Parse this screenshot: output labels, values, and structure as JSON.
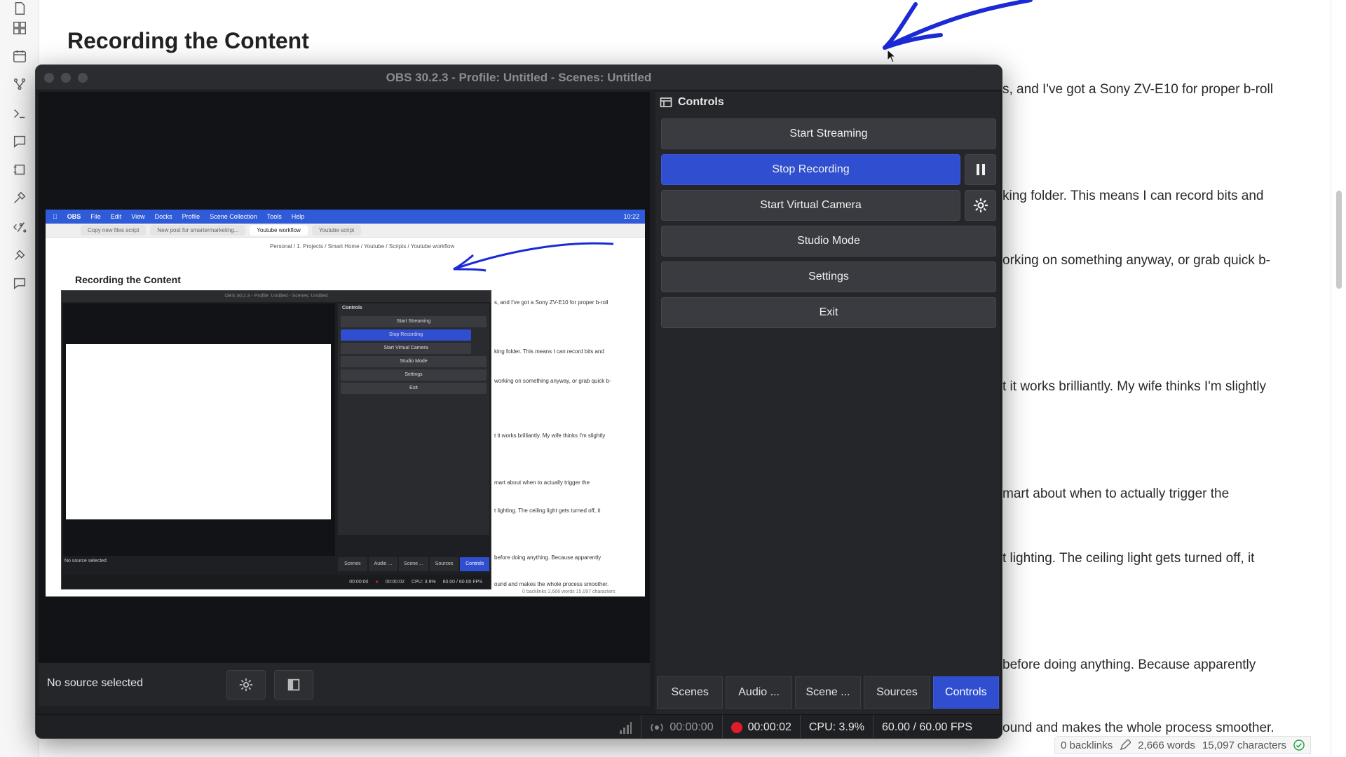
{
  "note": {
    "title": "Recording the Content",
    "lines": [
      "s, and I've got a Sony ZV-E10 for proper b-roll",
      "king folder. This means I can record bits and",
      "orking on something anyway, or grab quick b-",
      "t it works brilliantly. My wife thinks I'm slightly",
      "mart about when to actually trigger the",
      "t lighting. The ceiling light gets turned off, it",
      "before doing anything. Because apparently",
      "ound and makes the whole process smoother."
    ],
    "status": {
      "backlinks": "0 backlinks",
      "words": "2,666 words",
      "characters": "15,097 characters"
    },
    "ribbon_icons": [
      "file-icon",
      "layout-icon",
      "calendar-icon",
      "graph-icon",
      "terminal-icon",
      "chat-icon",
      "canvas-icon",
      "tools-icon",
      "percent-icon",
      "command-icon",
      "comment-icon"
    ]
  },
  "obs": {
    "title": "OBS 30.2.3 - Profile: Untitled - Scenes: Untitled",
    "source_label": "No source selected",
    "dock_title": "Controls",
    "buttons": {
      "start_streaming": "Start Streaming",
      "stop_recording": "Stop Recording",
      "start_virtual_camera": "Start Virtual Camera",
      "studio_mode": "Studio Mode",
      "settings": "Settings",
      "exit": "Exit"
    },
    "tabs": [
      "Scenes",
      "Audio ...",
      "Scene ...",
      "Sources",
      "Controls"
    ],
    "active_tab": "Controls",
    "status": {
      "stream_time": "00:00:00",
      "rec_time": "00:00:02",
      "cpu": "CPU: 3.9%",
      "fps": "60.00 / 60.00 FPS"
    },
    "colors": {
      "accent": "#2f4fd0",
      "record": "#e11d2a",
      "annotation": "#1a2bd6"
    }
  },
  "nested": {
    "menubar": [
      "OBS",
      "File",
      "Edit",
      "View",
      "Docks",
      "Profile",
      "Scene Collection",
      "Tools",
      "Help"
    ],
    "clock": "10:22",
    "tabs": [
      "Copy new files script",
      "New post for smartermarketing...",
      "Youtube workflow",
      "Youtube script"
    ],
    "active_tab": "Youtube workflow",
    "breadcrumb": "Personal / 1. Projects / Smart Home / Youtube / Scripts / Youtube workflow",
    "title": "Recording the Content",
    "obs_title": "OBS 30.2.3 - Profile: Untitled - Scenes: Untitled",
    "controls": "Controls",
    "buttons": [
      "Start Streaming",
      "Stop Recording",
      "Start Virtual Camera",
      "Studio Mode",
      "Settings",
      "Exit"
    ],
    "tabs_bottom": [
      "Scenes",
      "Audio ...",
      "Scene ...",
      "Sources",
      "Controls"
    ],
    "source": "No source selected",
    "status": [
      "00:00:00",
      "00:00:02",
      "CPU: 3.9%",
      "60.00 / 60.00 FPS"
    ],
    "lines": [
      "s, and I've got a Sony ZV-E10 for proper b-roll",
      "king folder. This means I can record bits and",
      "working on something anyway, or grab quick b-",
      "t it works brilliantly. My wife thinks I'm slightly",
      "mart about when to actually trigger the",
      "t lighting. The ceiling light gets turned off, it",
      "before doing anything. Because apparently",
      "ound and makes the whole process smoother."
    ],
    "footer": "0 backlinks  2,666 words  15,097 characters"
  }
}
